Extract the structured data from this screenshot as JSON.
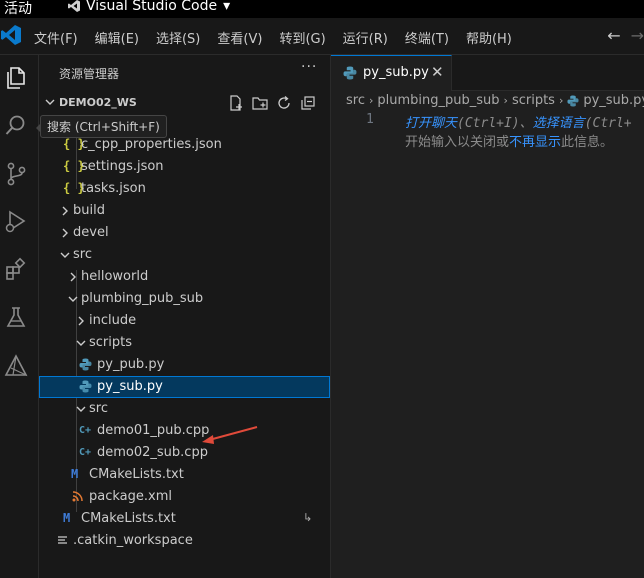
{
  "topbar": {
    "activities": "活动",
    "app_name": "Visual Studio Code",
    "dropdown_glyph": "▾"
  },
  "menubar": {
    "items": [
      "文件(F)",
      "编辑(E)",
      "选择(S)",
      "查看(V)",
      "转到(G)",
      "运行(R)",
      "终端(T)",
      "帮助(H)"
    ],
    "back_glyph": "←",
    "forward_glyph": "→"
  },
  "activity_bar": {
    "icons": [
      "explorer-icon",
      "search-icon",
      "source-control-icon",
      "run-debug-icon",
      "extensions-icon",
      "testing-icon",
      "cmake-icon"
    ],
    "tooltip": "搜索 (Ctrl+Shift+F)"
  },
  "sidebar": {
    "title": "资源管理器",
    "more_glyph": "···",
    "workspace": "DEMO02_WS",
    "tree": {
      "c_cpp_properties": "c_cpp_properties.json",
      "settings": "settings.json",
      "tasks": "tasks.json",
      "build": "build",
      "devel": "devel",
      "src": "src",
      "helloworld": "helloworld",
      "plumbing_pub_sub": "plumbing_pub_sub",
      "include": "include",
      "scripts": "scripts",
      "py_pub": "py_pub.py",
      "py_sub": "py_sub.py",
      "src_inner": "src",
      "demo01": "demo01_pub.cpp",
      "demo02": "demo02_sub.cpp",
      "cmake_inner": "CMakeLists.txt",
      "package": "package.xml",
      "cmake_root": "CMakeLists.txt",
      "catkin": ".catkin_workspace",
      "json_glyph": "{ }",
      "cpp_glyph": "C+",
      "cmake_glyph": "M",
      "git_marker": "↳"
    }
  },
  "editor": {
    "tab": {
      "label": "py_sub.py",
      "close_glyph": "✕"
    },
    "breadcrumb": [
      "src",
      "plumbing_pub_sub",
      "scripts",
      "py_sub.py"
    ],
    "breadcrumb_sep": "›",
    "line_number": "1",
    "hint": {
      "link1": "打开聊天",
      "key1": "(Ctrl+I)",
      "sep": "、",
      "link2": "选择语言",
      "key2": "(Ctrl+",
      "line2_a": "开始输入以关闭或",
      "link3": "不再显示",
      "line2_b": "此信息。"
    }
  },
  "colors": {
    "accent": "#0078d4",
    "selection": "#04395e",
    "folder_chevron": "#cccccc",
    "python_icon": "#519aba",
    "cpp_icon": "#519aba",
    "json_icon": "#cbcb41",
    "cmake_icon": "#3e7bd6",
    "xml_icon": "#e37933",
    "annotation_arrow": "#e04a3a"
  }
}
